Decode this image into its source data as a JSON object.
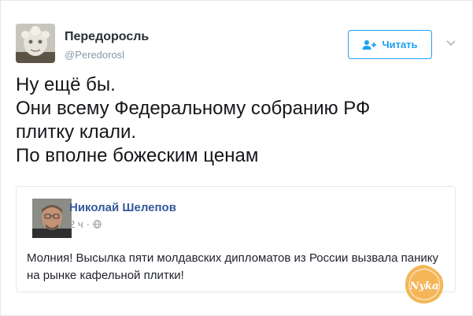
{
  "tweet": {
    "author_name": "Передоросль",
    "author_handle": "@Peredorosl",
    "follow_label": "Читать",
    "text_lines": [
      "Ну ещё бы.",
      "Они всему Федеральному собранию РФ",
      "плитку клали.",
      "По вполне божеским ценам"
    ]
  },
  "quoted_post": {
    "author_name": "Николай Шелепов",
    "time": "2 ч",
    "separator": "·",
    "text": "Молния! Высылка пяти молдавских дипломатов из России вызвала панику на рынке кафельной плитки!"
  },
  "watermark": {
    "text": "Nyka"
  },
  "colors": {
    "accent": "#1da1f2",
    "facebook_name": "#365899",
    "muted": "#8899a6",
    "border": "#e1e8ed",
    "watermark": "#f2a93b"
  },
  "icons": {
    "follow": "add-user-icon",
    "menu": "chevron-down-icon",
    "privacy": "globe-icon"
  }
}
